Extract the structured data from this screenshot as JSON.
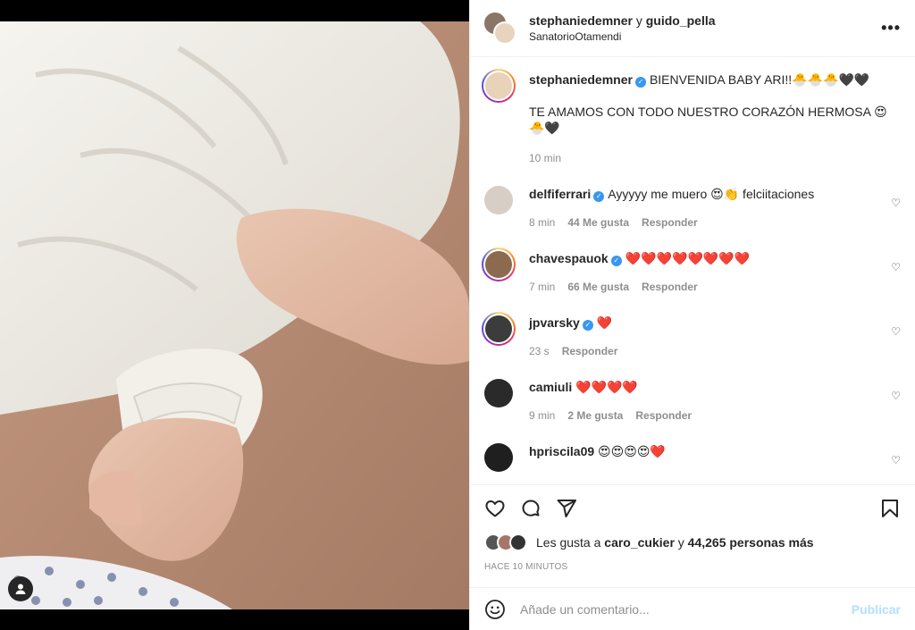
{
  "post": {
    "author_primary": "stephaniedemner",
    "connector": "y",
    "author_secondary": "guido_pella",
    "location": "SanatorioOtamendi",
    "more_label": "•••"
  },
  "caption": {
    "user": "stephaniedemner",
    "line1": "BIENVENIDA BABY ARI!!🐣🐣🐣🖤🖤",
    "line2": "TE AMAMOS CON TODO NUESTRO CORAZÓN HERMOSA 😍 🐣🖤",
    "time": "10 min"
  },
  "comments": [
    {
      "user": "delfiferrari",
      "verified": true,
      "text": "Ayyyyy me muero 😍👏 felciitaciones",
      "time": "8 min",
      "likes": "44 Me gusta",
      "reply": "Responder",
      "avatar_color": "#d7cfc6"
    },
    {
      "user": "chavespauok",
      "verified": true,
      "text": "❤️❤️❤️❤️❤️❤️❤️❤️",
      "time": "7 min",
      "likes": "66 Me gusta",
      "reply": "Responder",
      "avatar_color": "#8b6a4e"
    },
    {
      "user": "jpvarsky",
      "verified": true,
      "text": "❤️",
      "time": "23 s",
      "likes": "",
      "reply": "Responder",
      "avatar_color": "#3c3c3c"
    },
    {
      "user": "camiuli",
      "verified": false,
      "text": "❤️❤️❤️❤️",
      "time": "9 min",
      "likes": "2 Me gusta",
      "reply": "Responder",
      "avatar_color": "#2a2a2a"
    },
    {
      "user": "hpriscila09",
      "verified": false,
      "text": "😍😍😍😍❤️",
      "time": "",
      "likes": "",
      "reply": "",
      "avatar_color": "#1f1f1f"
    }
  ],
  "likes": {
    "prefix": "Les gusta a",
    "user": "caro_cukier",
    "middle": "y",
    "count": "44,265 personas más"
  },
  "posted_ago": "HACE 10 MINUTOS",
  "add_comment": {
    "placeholder": "Añade un comentario...",
    "publish_label": "Publicar"
  },
  "colors": {
    "verified": "#3897f0",
    "publish_disabled": "#b2dffc",
    "meta": "#8e8e8e"
  }
}
